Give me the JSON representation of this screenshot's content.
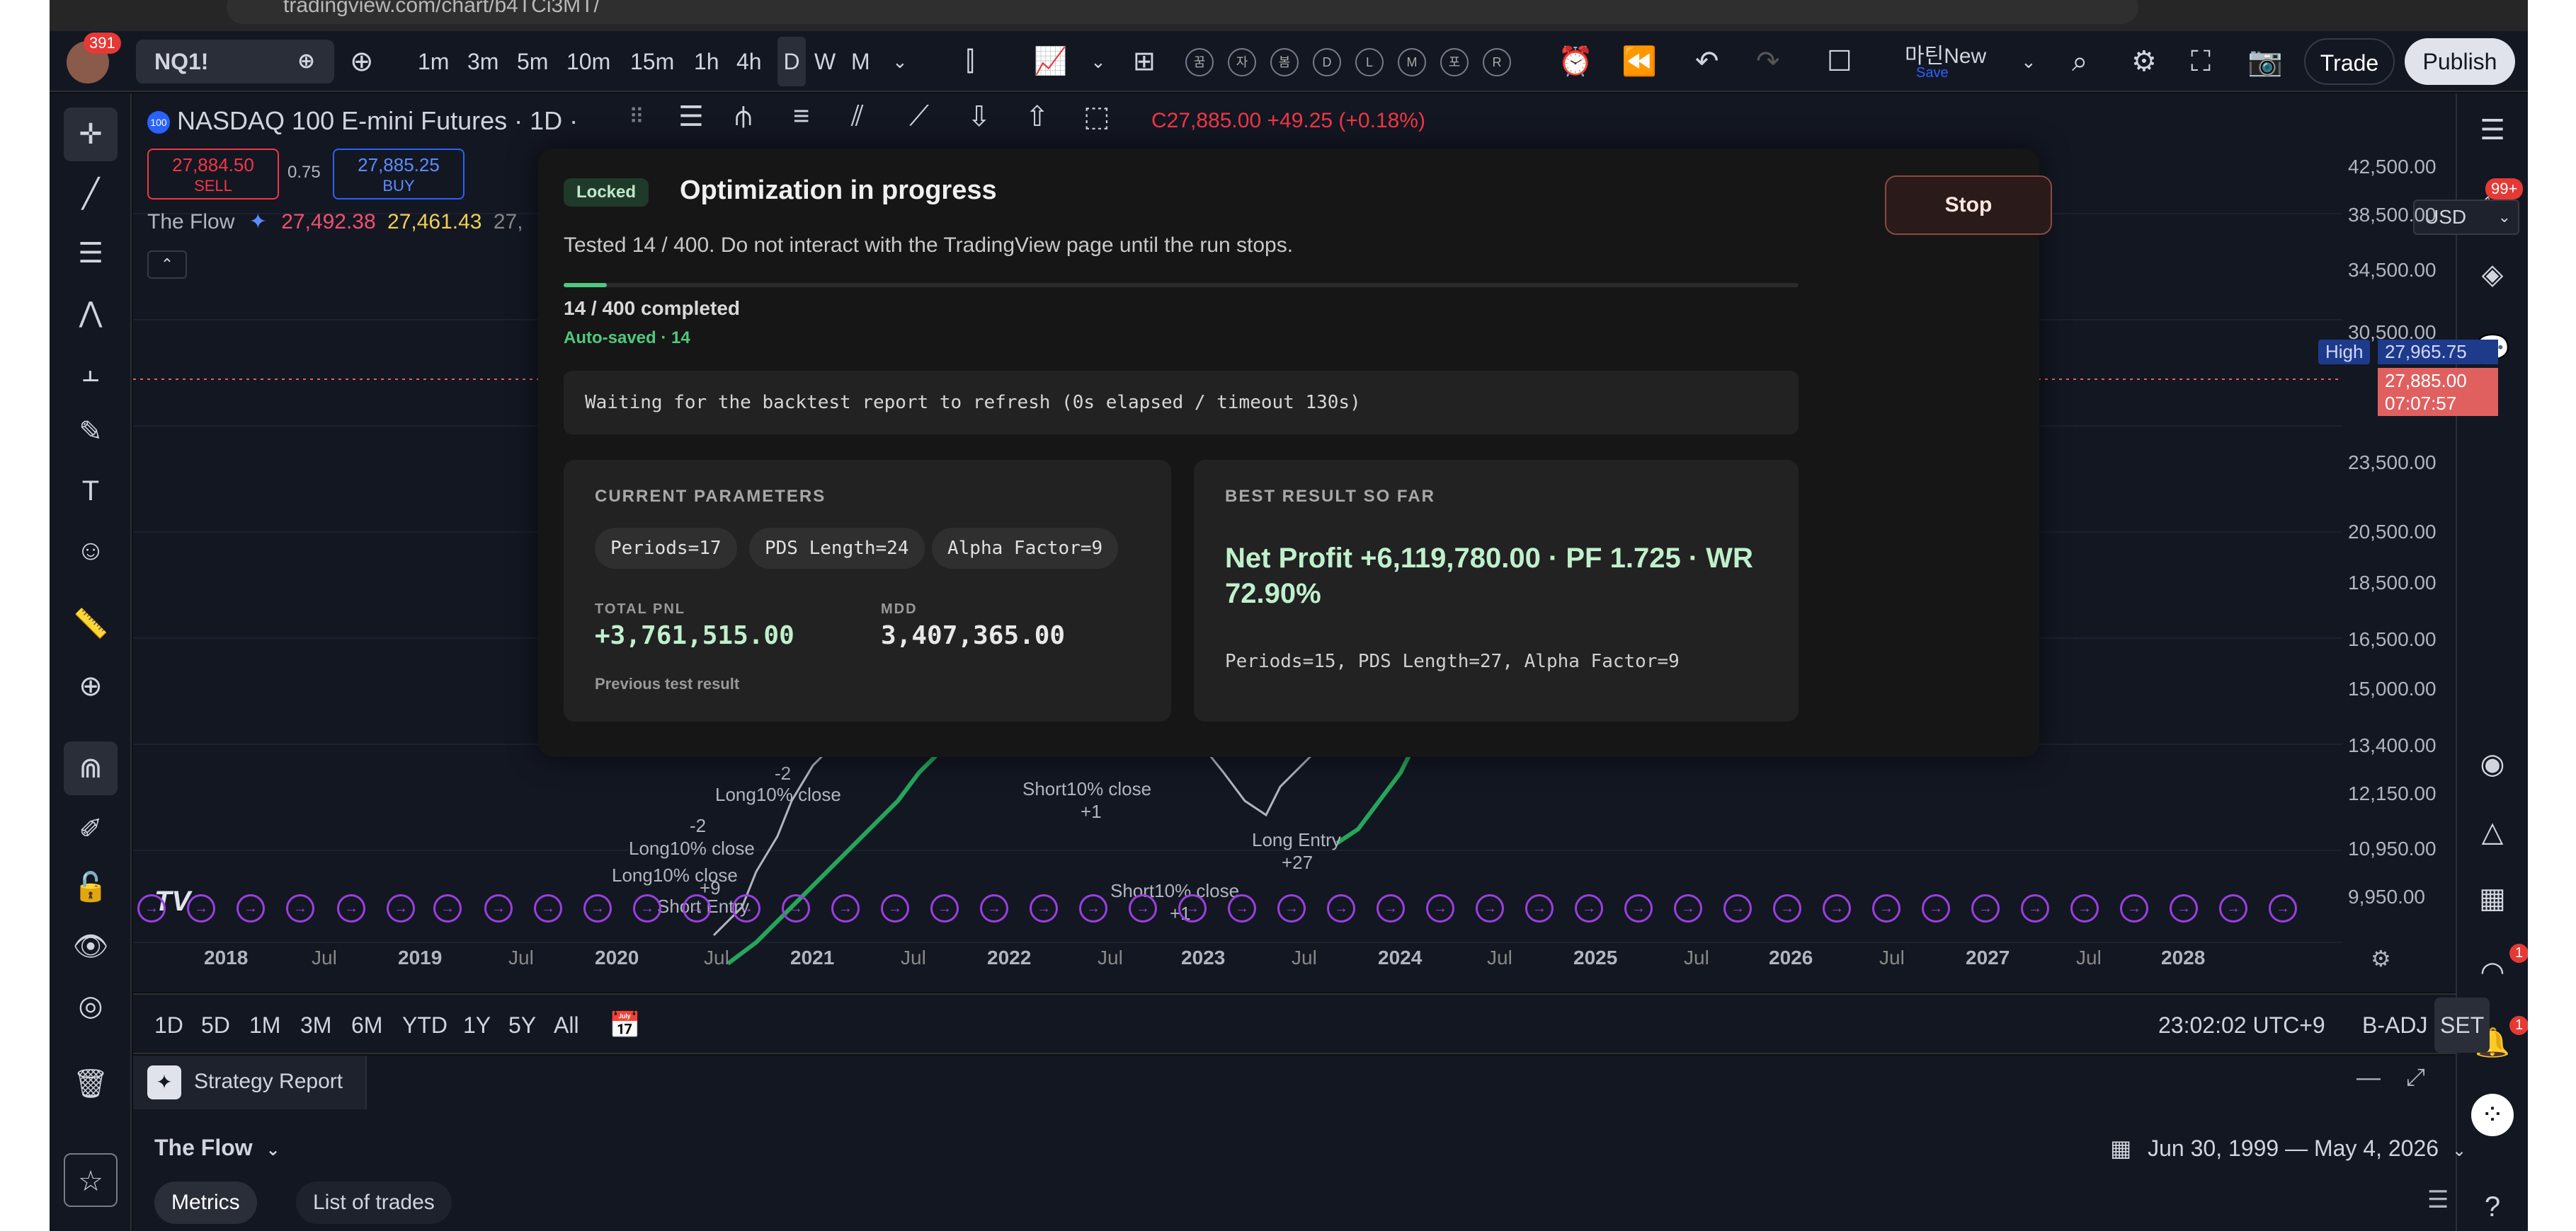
{
  "browser": {
    "url": "tradingview.com/chart/b4TCi3MT/"
  },
  "header": {
    "notifications": "391",
    "symbol": "NQ1!",
    "intervals": [
      "1m",
      "3m",
      "5m",
      "10m",
      "15m",
      "1h",
      "4h",
      "D",
      "W",
      "M"
    ],
    "active_interval": "D",
    "mini_buttons": [
      "꿈",
      "자",
      "봄",
      "D",
      "L",
      "M",
      "포",
      "R"
    ],
    "layout_name": "마틴New",
    "layout_sub": "Save",
    "trade": "Trade",
    "publish": "Publish"
  },
  "chart": {
    "title": "NASDAQ 100 E-mini Futures · 1D ·",
    "ohlc_close": "C27,885.00",
    "ohlc_change": "+49.25 (+0.18%)",
    "sell_price": "27,884.50",
    "sell_label": "SELL",
    "spread": "0.75",
    "buy_price": "27,885.25",
    "buy_label": "BUY",
    "indicator_name": "The Flow",
    "indicator_v1": "27,492.38",
    "indicator_v2": "27,461.43",
    "indicator_v3": "27,",
    "currency": "USD",
    "price_levels": [
      "42,500.00",
      "38,500.00",
      "34,500.00",
      "30,500.00",
      "23,500.00",
      "20,500.00",
      "18,500.00",
      "16,500.00",
      "15,000.00",
      "13,400.00",
      "12,150.00",
      "10,950.00",
      "9,950.00"
    ],
    "high_label": "High",
    "high_value": "27,965.75",
    "last_price": "27,885.00",
    "countdown": "07:07:57",
    "years": [
      "2018",
      "2019",
      "2020",
      "2021",
      "2022",
      "2023",
      "2024",
      "2025",
      "2026",
      "2027",
      "2028"
    ],
    "month_label": "Jul",
    "labels": {
      "l1": "Long10% close",
      "l2": "Long10% close",
      "l3": "Long10% close",
      "short_entry": "Short Entry",
      "short_close_a": "Short10% close",
      "short_close_b": "Short10% close",
      "long_entry": "Long Entry",
      "n_m2a": "-2",
      "n_m2b": "-2",
      "n_p1a": "+1",
      "n_p1b": "+1",
      "n_p27": "+27",
      "n_p9": "+9"
    },
    "logo": "TV"
  },
  "bottombar": {
    "ranges": [
      "1D",
      "5D",
      "1M",
      "3M",
      "6M",
      "YTD",
      "1Y",
      "5Y",
      "All"
    ],
    "time": "23:02:02 UTC+9",
    "badj": "B-ADJ",
    "set": "SET"
  },
  "report": {
    "tab": "Strategy Report",
    "strategy": "The Flow",
    "date_range": "Jun 30, 1999 — May 4, 2026",
    "tabs": [
      "Metrics",
      "List of trades"
    ]
  },
  "right_badges": {
    "top": "99+",
    "b1": "1",
    "b2": "1"
  },
  "modal": {
    "locked": "Locked",
    "title": "Optimization in progress",
    "stop": "Stop",
    "desc": "Tested 14 / 400. Do not interact with the TradingView page until the run stops.",
    "progress": 0.035,
    "progress_text": "14 / 400 completed",
    "autosaved": "Auto-saved · 14",
    "waiting": "Waiting for the backtest report to refresh (0s elapsed / timeout 130s)",
    "current": {
      "title": "CURRENT PARAMETERS",
      "chips": [
        "Periods=17",
        "PDS Length=24",
        "Alpha Factor=9"
      ],
      "pnl_label": "TOTAL PNL",
      "pnl_value": "+3,761,515.00",
      "mdd_label": "MDD",
      "mdd_value": "3,407,365.00",
      "note": "Previous test result"
    },
    "best": {
      "title": "BEST RESULT SO FAR",
      "headline": "Net Profit +6,119,780.00 · PF 1.725 · WR 72.90%",
      "params": "Periods=15, PDS Length=27, Alpha Factor=9"
    }
  },
  "colors": {
    "accent_green": "#4ec97d",
    "sell_red": "#f23645",
    "buy_blue": "#2962ff",
    "event_purple": "#9b3fe0"
  }
}
